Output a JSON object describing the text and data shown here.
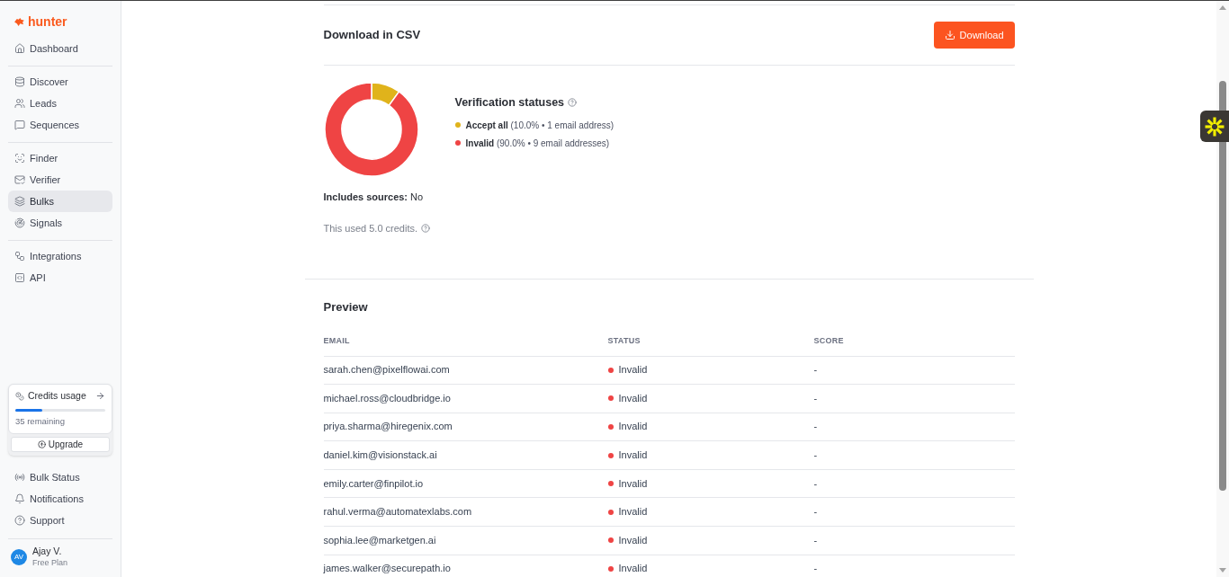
{
  "sidebar": {
    "logo": "hunter",
    "sections": [
      {
        "items": [
          {
            "label": "Dashboard",
            "selected": false
          }
        ]
      },
      {
        "items": [
          {
            "label": "Discover",
            "selected": false
          },
          {
            "label": "Leads",
            "selected": false
          },
          {
            "label": "Sequences",
            "selected": false
          }
        ]
      },
      {
        "items": [
          {
            "label": "Finder",
            "selected": false
          },
          {
            "label": "Verifier",
            "selected": false
          },
          {
            "label": "Bulks",
            "selected": true
          },
          {
            "label": "Signals",
            "selected": false
          }
        ]
      },
      {
        "items": [
          {
            "label": "Integrations",
            "selected": false
          },
          {
            "label": "API",
            "selected": false
          }
        ]
      }
    ],
    "credits": {
      "title": "Credits usage",
      "level": 0.3,
      "remaining": "35 remaining",
      "upgrade": "Upgrade"
    },
    "footer_items": [
      {
        "label": "Bulk Status",
        "selected": false
      },
      {
        "label": "Notifications",
        "selected": false
      },
      {
        "label": "Support",
        "selected": false
      }
    ],
    "user": {
      "initials": "AV",
      "name": "Ajay V.",
      "plan": "Free Plan"
    }
  },
  "export": {
    "title": "Download in CSV",
    "button": "Download"
  },
  "verification": {
    "title": "Verification statuses",
    "chart_data": {
      "type": "donut",
      "values": [
        10.0,
        90.0
      ]
    },
    "items": [
      {
        "label": "Accept all",
        "detail": "(10.0% • 1 email address)",
        "color": "#e0b31b"
      },
      {
        "label": "Invalid",
        "detail": "(90.0% • 9 email addresses)",
        "color": "#ef4444"
      }
    ]
  },
  "includes_sources": "**Includes sources:** No",
  "credits_used": "This used 5.0 credits.",
  "preview": {
    "title": "Preview",
    "columns": [
      "EMAIL",
      "STATUS",
      "SCORE"
    ],
    "rows": [
      {
        "email": "sarah.chen@pixelflowai.com",
        "status": "Invalid",
        "color": "#ef4444",
        "score": "-"
      },
      {
        "email": "michael.ross@cloudbridge.io",
        "status": "Invalid",
        "color": "#ef4444",
        "score": "-"
      },
      {
        "email": "priya.sharma@hiregenix.com",
        "status": "Invalid",
        "color": "#ef4444",
        "score": "-"
      },
      {
        "email": "daniel.kim@visionstack.ai",
        "status": "Invalid",
        "color": "#ef4444",
        "score": "-"
      },
      {
        "email": "emily.carter@finpilot.io",
        "status": "Invalid",
        "color": "#ef4444",
        "score": "-"
      },
      {
        "email": "rahul.verma@automatexlabs.com",
        "status": "Invalid",
        "color": "#ef4444",
        "score": "-"
      },
      {
        "email": "sophia.lee@marketgen.ai",
        "status": "Invalid",
        "color": "#ef4444",
        "score": "-"
      },
      {
        "email": "james.walker@securepath.io",
        "status": "Invalid",
        "color": "#ef4444",
        "score": "-"
      }
    ]
  }
}
